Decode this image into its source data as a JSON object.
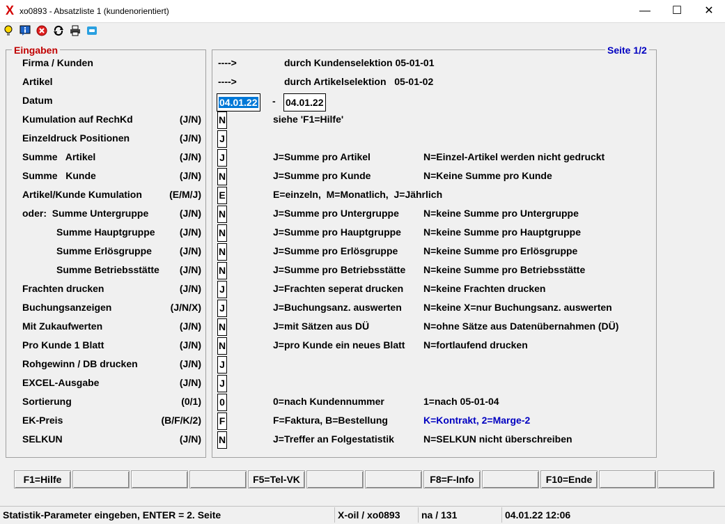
{
  "window": {
    "title": "xo0893 - Absatzliste 1 (kundenorientiert)",
    "app_icon": "X",
    "controls": [
      "—",
      "☐",
      "✕"
    ]
  },
  "toolbar": {
    "icons": [
      "lightbulb-icon",
      "info-icon",
      "cancel-icon",
      "refresh-icon",
      "printer-icon",
      "chat-icon"
    ]
  },
  "inputs": {
    "legend": "Eingaben",
    "page": "Seite 1/2",
    "rows": [
      {
        "label": "Firma / Kunden",
        "opts": "",
        "value": "",
        "desc1": "durch Kundenselektion 05-01-01",
        "desc2": ""
      },
      {
        "label": "Artikel",
        "opts": "",
        "value": "",
        "desc1": "durch Artikelselektion   05-01-02",
        "desc2": ""
      },
      {
        "label": "Datum",
        "opts": "",
        "value": "",
        "desc1": "",
        "desc2": ""
      },
      {
        "label": "Kumulation auf RechKd",
        "opts": "(J/N)",
        "value": "N",
        "desc1": "siehe 'F1=Hilfe'",
        "desc2": ""
      },
      {
        "label": "Einzeldruck Positionen",
        "opts": "(J/N)",
        "value": "J",
        "desc1": "",
        "desc2": ""
      },
      {
        "label": "Summe   Artikel",
        "opts": "(J/N)",
        "value": "J",
        "desc1": "J=Summe pro Artikel",
        "desc2": "N=Einzel-Artikel werden nicht gedruckt"
      },
      {
        "label": "Summe   Kunde",
        "opts": "(J/N)",
        "value": "N",
        "desc1": "J=Summe pro Kunde",
        "desc2": "N=Keine Summe pro Kunde"
      },
      {
        "label": "Artikel/Kunde Kumulation",
        "opts": "(E/M/J)",
        "value": "E",
        "desc1": "E=einzeln,  M=Monatlich,  J=Jährlich",
        "desc2": ""
      },
      {
        "label": "oder:  Summe Untergruppe",
        "opts": "(J/N)",
        "value": "N",
        "desc1": "J=Summe pro Untergruppe",
        "desc2": "N=keine Summe pro Untergruppe"
      },
      {
        "label": "Summe Hauptgruppe",
        "opts": "(J/N)",
        "value": "N",
        "desc1": "J=Summe pro Hauptgruppe",
        "desc2": "N=keine Summe pro Hauptgruppe"
      },
      {
        "label": "Summe Erlösgruppe",
        "opts": "(J/N)",
        "value": "N",
        "desc1": "J=Summe pro Erlösgruppe",
        "desc2": "N=keine Summe pro Erlösgruppe"
      },
      {
        "label": "Summe Betriebsstätte",
        "opts": "(J/N)",
        "value": "N",
        "desc1": "J=Summe pro Betriebsstätte",
        "desc2": "N=keine Summe pro Betriebsstätte"
      },
      {
        "label": "Frachten drucken",
        "opts": "(J/N)",
        "value": "J",
        "desc1": "J=Frachten seperat drucken",
        "desc2": "N=keine Frachten drucken"
      },
      {
        "label": "Buchungsanzeigen",
        "opts": "(J/N/X)",
        "value": "J",
        "desc1": "J=Buchungsanz. auswerten",
        "desc2": "N=keine X=nur Buchungsanz. auswerten"
      },
      {
        "label": "Mit Zukaufwerten",
        "opts": "(J/N)",
        "value": "N",
        "desc1": "J=mit Sätzen aus DÜ",
        "desc2": "N=ohne Sätze aus Datenübernahmen (DÜ)"
      },
      {
        "label": "Pro Kunde 1 Blatt",
        "opts": "(J/N)",
        "value": "N",
        "desc1": "J=pro Kunde ein neues Blatt",
        "desc2": "N=fortlaufend drucken"
      },
      {
        "label": "Rohgewinn / DB drucken",
        "opts": "(J/N)",
        "value": "J",
        "desc1": "",
        "desc2": ""
      },
      {
        "label": "EXCEL-Ausgabe",
        "opts": "(J/N)",
        "value": "J",
        "desc1": "",
        "desc2": ""
      },
      {
        "label": "Sortierung",
        "opts": "(0/1)",
        "value": "0",
        "desc1": "0=nach Kundennummer",
        "desc2": "1=nach 05-01-04"
      },
      {
        "label": "EK-Preis",
        "opts": "(B/F/K/2)",
        "value": "F",
        "desc1": "F=Faktura, B=Bestellung",
        "desc2": "K=Kontrakt, 2=Marge-2"
      },
      {
        "label": "SELKUN",
        "opts": "(J/N)",
        "value": "N",
        "desc1": "J=Treffer an Folgestatistik",
        "desc2": "N=SELKUN nicht überschreiben"
      }
    ],
    "arrow": "---->",
    "date_from": "04.01.22",
    "date_sep": "-",
    "date_to": "04.01.22"
  },
  "fkeys": [
    "F1=Hilfe",
    "",
    "",
    "",
    "F5=Tel-VK",
    "",
    "",
    "F8=F-Info",
    "",
    "F10=Ende",
    "",
    ""
  ],
  "status": {
    "message": "Statistik-Parameter eingeben, ENTER = 2. Seite",
    "system": "X-oil / xo0893",
    "count": "na / 131",
    "datetime": "04.01.22 12:06"
  },
  "colors": {
    "legend": "#c00000",
    "page": "#0000c0",
    "highlight_desc": "#0000c0",
    "selection": "#0078d7"
  }
}
